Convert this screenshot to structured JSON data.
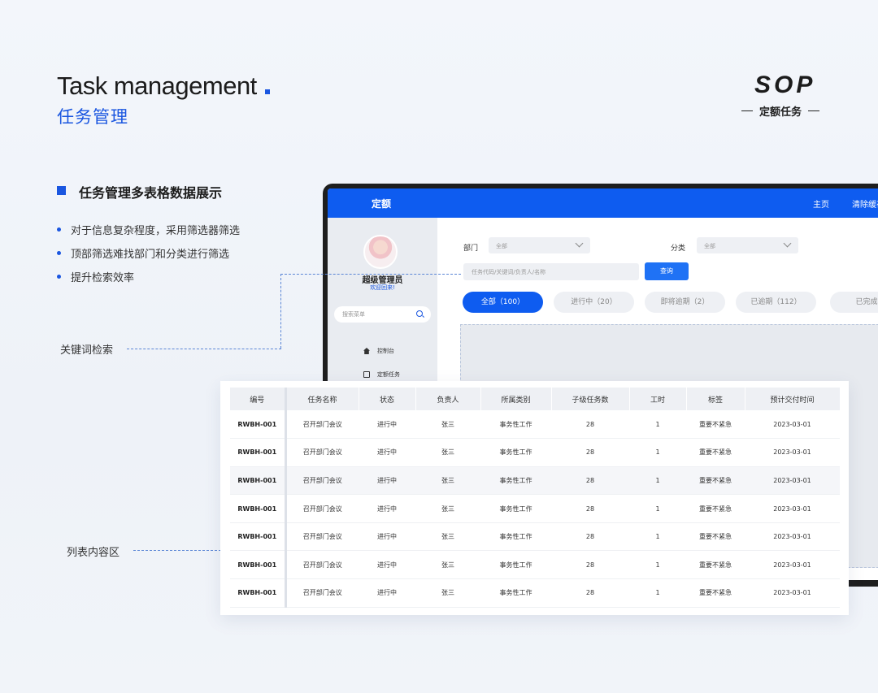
{
  "header": {
    "title_en": "Task management",
    "title_cn": "任务管理",
    "brand": "SOP",
    "brand_sub": "定额任务"
  },
  "feature": {
    "title": "任务管理多表格数据展示",
    "bullets": [
      "对于信息复杂程度，采用筛选器筛选",
      "顶部筛选难找部门和分类进行筛选",
      "提升检索效率"
    ]
  },
  "annotations": {
    "keyword_search": "关键词检索",
    "list_area": "列表内容区"
  },
  "app": {
    "topbar": {
      "brand": "定额",
      "home": "主页",
      "clear": "清除缓存"
    },
    "sidebar": {
      "user_name": "超级管理员",
      "welcome": "欢迎回来!",
      "search_placeholder": "搜索菜单",
      "menu": [
        "控制台",
        "定额任务"
      ]
    },
    "filters": {
      "dept_label": "部门",
      "dept_value": "全部",
      "category_label": "分类",
      "category_value": "全部",
      "keyword_placeholder": "任务代码/关键词/负责人/名称",
      "query_label": "查询"
    },
    "status_tabs": [
      "全部（100）",
      "进行中（20）",
      "即将逾期（2）",
      "已逾期（112）",
      "已完成"
    ]
  },
  "table": {
    "columns": [
      "编号",
      "任务名称",
      "状态",
      "负责人",
      "所属类别",
      "子级任务数",
      "工时",
      "标签",
      "预计交付时间"
    ],
    "rows": [
      [
        "RWBH-001",
        "召开部门会议",
        "进行中",
        "张三",
        "事务性工作",
        "28",
        "1",
        "重要不紧急",
        "2023-03-01"
      ],
      [
        "RWBH-001",
        "召开部门会议",
        "进行中",
        "张三",
        "事务性工作",
        "28",
        "1",
        "重要不紧急",
        "2023-03-01"
      ],
      [
        "RWBH-001",
        "召开部门会议",
        "进行中",
        "张三",
        "事务性工作",
        "28",
        "1",
        "重要不紧急",
        "2023-03-01"
      ],
      [
        "RWBH-001",
        "召开部门会议",
        "进行中",
        "张三",
        "事务性工作",
        "28",
        "1",
        "重要不紧急",
        "2023-03-01"
      ],
      [
        "RWBH-001",
        "召开部门会议",
        "进行中",
        "张三",
        "事务性工作",
        "28",
        "1",
        "重要不紧急",
        "2023-03-01"
      ],
      [
        "RWBH-001",
        "召开部门会议",
        "进行中",
        "张三",
        "事务性工作",
        "28",
        "1",
        "重要不紧急",
        "2023-03-01"
      ],
      [
        "RWBH-001",
        "召开部门会议",
        "进行中",
        "张三",
        "事务性工作",
        "28",
        "1",
        "重要不紧急",
        "2023-03-01"
      ]
    ]
  },
  "colors": {
    "accent": "#1a56e0",
    "topbar": "#0e5cf0",
    "button": "#1f72f5"
  }
}
